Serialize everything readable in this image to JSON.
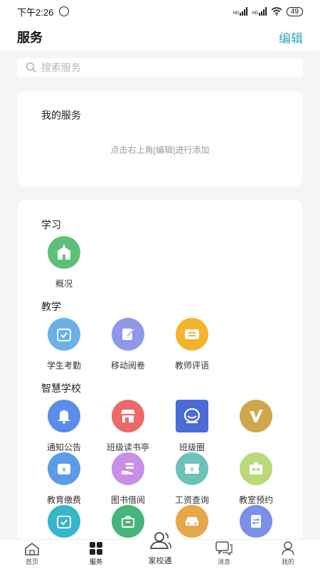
{
  "status_bar": {
    "time": "下午2:26",
    "battery": "49",
    "sig_label": "HD"
  },
  "header": {
    "title": "服务",
    "edit": "编辑"
  },
  "search": {
    "placeholder": "搜索服务"
  },
  "my_services": {
    "title": "我的服务",
    "hint": "点击右上角[编辑]进行添加"
  },
  "sections": {
    "study": {
      "title": "学习",
      "items": [
        {
          "label": "概况",
          "icon": "school-icon",
          "color": "#5fbf7a"
        }
      ]
    },
    "teaching": {
      "title": "教学",
      "items": [
        {
          "label": "学生考勤",
          "icon": "calendar-check-icon",
          "color": "#6ab0e6"
        },
        {
          "label": "移动阅卷",
          "icon": "pen-paper-icon",
          "color": "#8f97e8"
        },
        {
          "label": "教师评语",
          "icon": "comment-card-icon",
          "color": "#f4b42a"
        }
      ]
    },
    "smart": {
      "title": "智慧学校",
      "items": [
        {
          "label": "通知公告",
          "icon": "bell-icon",
          "color": "#5b8de8"
        },
        {
          "label": "班级读书亭",
          "icon": "store-icon",
          "color": "#e86a6a"
        },
        {
          "label": "班级圈",
          "icon": "chat-bubble-icon",
          "color": "#4b6bd8"
        },
        {
          "label": "",
          "icon": "v-badge-icon",
          "color": "#d0a64a"
        },
        {
          "label": "教育缴费",
          "icon": "payment-icon",
          "color": "#5b9be8"
        },
        {
          "label": "图书借阅",
          "icon": "book-hand-icon",
          "color": "#c790e6"
        },
        {
          "label": "工资查询",
          "icon": "salary-ticket-icon",
          "color": "#6cc2b6"
        },
        {
          "label": "教室预约",
          "icon": "classroom-icon",
          "color": "#b9d97a"
        },
        {
          "label": "",
          "icon": "calendar-check-icon",
          "color": "#36b6c8"
        },
        {
          "label": "",
          "icon": "basket-icon",
          "color": "#47b57a"
        },
        {
          "label": "",
          "icon": "car-icon",
          "color": "#e6a64a"
        },
        {
          "label": "",
          "icon": "document-swap-icon",
          "color": "#7c8fe8"
        }
      ]
    }
  },
  "tabbar": {
    "home": "首页",
    "services": "服务",
    "center": "家校通",
    "messages": "消息",
    "mine": "我的"
  }
}
